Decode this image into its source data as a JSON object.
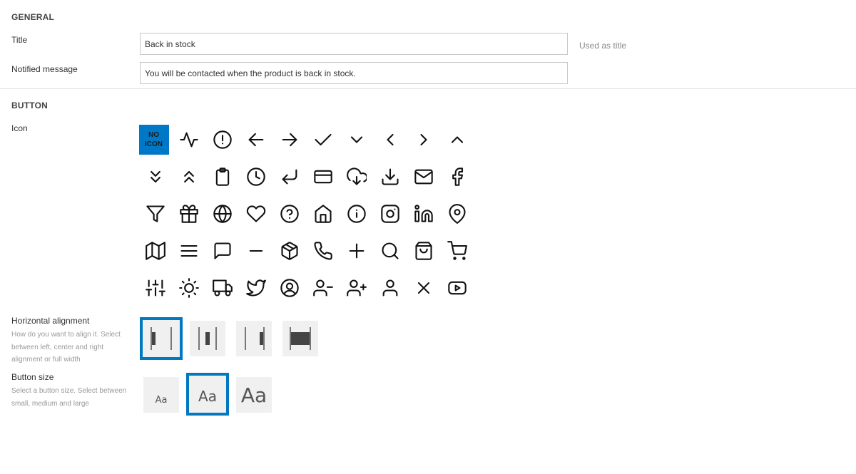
{
  "general": {
    "section_title": "GENERAL",
    "title_label": "Title",
    "title_value": "Back in stock",
    "title_hint": "Used as title",
    "message_label": "Notified message",
    "message_value": "You will be contacted when the product is back in stock."
  },
  "button": {
    "section_title": "BUTTON",
    "icon_label": "Icon",
    "no_icon_line1": "NO",
    "no_icon_line2": "ICON",
    "selected_icon": "no-icon",
    "icons": [
      "no-icon",
      "activity",
      "alert-circle",
      "arrow-left",
      "arrow-right",
      "check",
      "chevron-down",
      "chevron-left",
      "chevron-right",
      "chevron-up",
      "chevrons-down",
      "chevrons-up",
      "clipboard",
      "clock",
      "corner-down-left",
      "credit-card",
      "download-cloud",
      "download",
      "mail",
      "facebook",
      "filter",
      "gift",
      "globe",
      "heart",
      "help-circle",
      "home",
      "info",
      "instagram",
      "linkedin",
      "map-pin",
      "map",
      "menu",
      "message-square",
      "minus",
      "package",
      "phone",
      "plus",
      "search",
      "shopping-bag",
      "shopping-cart",
      "sliders",
      "sun",
      "truck",
      "twitter",
      "user-circle",
      "user-minus",
      "user-plus",
      "user",
      "x",
      "youtube"
    ],
    "h_align_label": "Horizontal alignment",
    "h_align_desc": "How do you want to align it. Select between left, center and right alignment or full width",
    "h_align_options": [
      "left",
      "center",
      "right",
      "full-width"
    ],
    "h_align_selected": "left",
    "size_label": "Button size",
    "size_desc": "Select a button size. Select between small, medium and large",
    "size_options": [
      {
        "id": "small",
        "text": "Aa"
      },
      {
        "id": "medium",
        "text": "Aa"
      },
      {
        "id": "large",
        "text": "Aa"
      }
    ],
    "size_selected": "medium"
  },
  "colors": {
    "accent": "#0079c1",
    "no_icon_bg": "#0078c8",
    "option_bg": "#f0f0f0"
  }
}
